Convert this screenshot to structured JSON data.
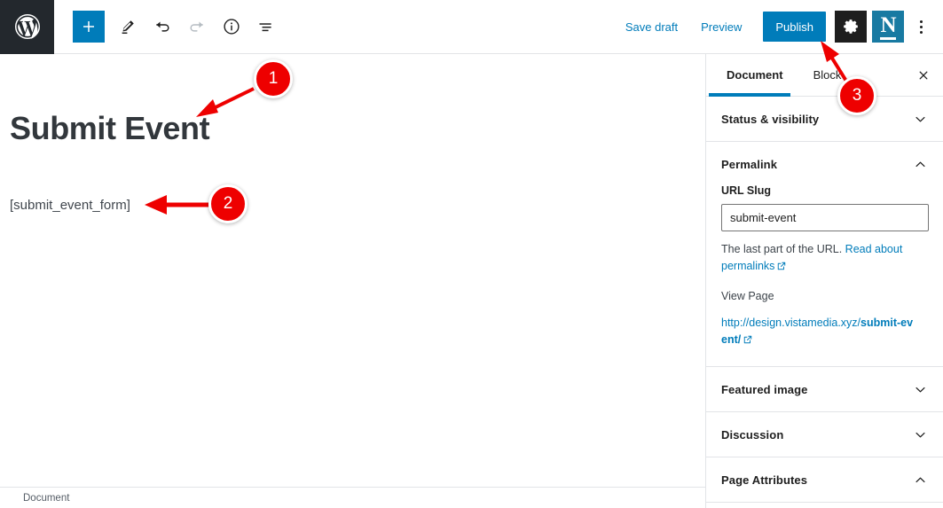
{
  "header": {
    "logo_icon": "wordpress-logo-icon",
    "tools": [
      {
        "name": "add-block-button",
        "icon": "plus-icon",
        "label": "Add block",
        "state": "active"
      },
      {
        "name": "edit-tool-button",
        "icon": "pencil-icon",
        "label": "Edit",
        "state": "normal"
      },
      {
        "name": "undo-button",
        "icon": "undo-arrow-icon",
        "label": "Undo",
        "state": "normal"
      },
      {
        "name": "redo-button",
        "icon": "redo-arrow-icon",
        "label": "Redo",
        "state": "disabled"
      },
      {
        "name": "details-button",
        "icon": "info-circle-icon",
        "label": "Details",
        "state": "normal"
      },
      {
        "name": "list-view-button",
        "icon": "list-view-icon",
        "label": "List view",
        "state": "normal"
      }
    ],
    "save_draft_label": "Save draft",
    "preview_label": "Preview",
    "publish_label": "Publish",
    "settings_icon": "gear-icon",
    "seo_plugin_icon": "yoast-n-icon",
    "seo_plugin_letter": "N",
    "more_menu_icon": "kebab-menu-icon"
  },
  "editor": {
    "post_title": "Submit Event",
    "shortcode_block": "[submit_event_form]"
  },
  "bottom_bar": {
    "breadcrumb": "Document"
  },
  "sidebar": {
    "tabs": [
      {
        "label": "Document",
        "active": true
      },
      {
        "label": "Block",
        "active": false
      }
    ],
    "close_icon": "close-x-icon",
    "panels": [
      {
        "title": "Status & visibility",
        "expanded": false,
        "chevron": "chevron-down-icon"
      },
      {
        "title": "Permalink",
        "expanded": true,
        "chevron": "chevron-up-icon"
      },
      {
        "title": "Featured image",
        "expanded": false,
        "chevron": "chevron-down-icon"
      },
      {
        "title": "Discussion",
        "expanded": false,
        "chevron": "chevron-down-icon"
      },
      {
        "title": "Page Attributes",
        "expanded": true,
        "chevron": "chevron-up-icon"
      }
    ],
    "permalink": {
      "url_slug_label": "URL Slug",
      "url_slug_value": "submit-event",
      "url_slug_placeholder": "submit-event",
      "help_prefix": "The last part of the URL.",
      "help_link": "Read about permalinks",
      "help_link_icon": "external-link-icon",
      "view_page_label": "View Page",
      "permalink_base": "http://design.vistamedia.xyz/",
      "permalink_slug": "submit-event/",
      "permalink_icon": "external-link-icon"
    }
  },
  "annotations": [
    {
      "number": "1",
      "name": "annotation-marker-1"
    },
    {
      "number": "2",
      "name": "annotation-marker-2"
    },
    {
      "number": "3",
      "name": "annotation-marker-3"
    }
  ],
  "colors": {
    "wp_blue": "#007cba",
    "admin_dark": "#23282d",
    "yoast_blue": "#187aa2",
    "marker_red": "#ee0000",
    "border": "#e2e4e7"
  }
}
